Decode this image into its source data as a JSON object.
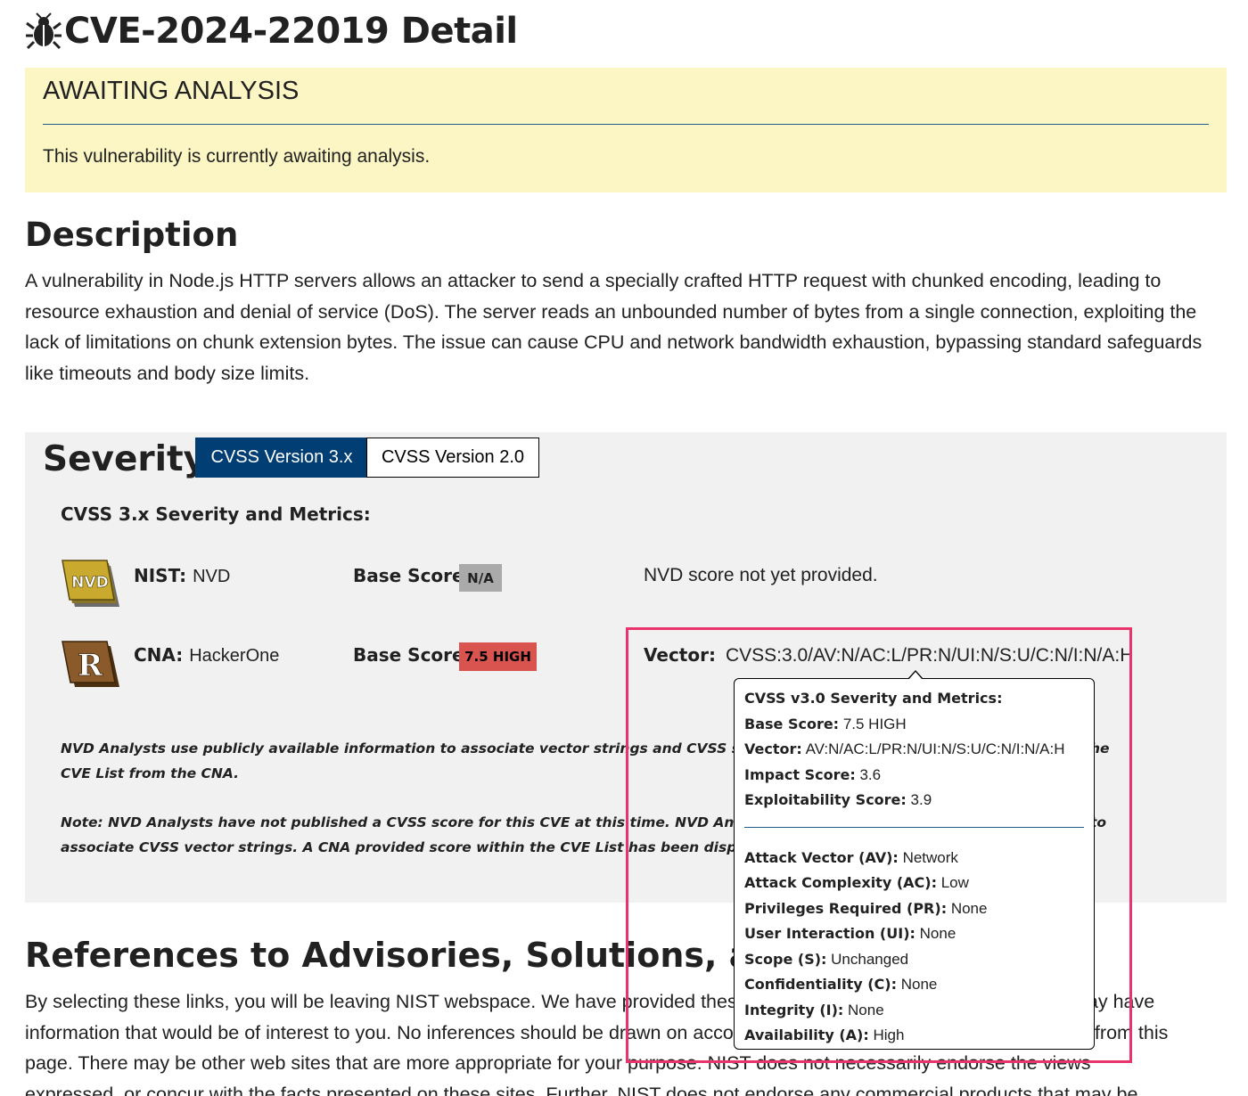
{
  "page": {
    "title": "CVE-2024-22019 Detail",
    "title_icon": "bug-icon"
  },
  "awaiting": {
    "title": "AWAITING ANALYSIS",
    "text": "This vulnerability is currently awaiting analysis."
  },
  "description": {
    "title": "Description",
    "text": "A vulnerability in Node.js HTTP servers allows an attacker to send a specially crafted HTTP request with chunked encoding, leading to resource exhaustion and denial of service (DoS). The server reads an unbounded number of bytes from a single connection, exploiting the lack of limitations on chunk extension bytes. The issue can cause CPU and network bandwidth exhaustion, bypassing standard safeguards like timeouts and body size limits."
  },
  "severity": {
    "title": "Severity",
    "tabs": [
      "CVSS Version 3.x",
      "CVSS Version 2.0"
    ],
    "metrics_title": "CVSS 3.x Severity and Metrics:",
    "nist_label": "NIST:",
    "nist_value": "NVD",
    "nvd_badge": "NVD",
    "base_score_label": "Base Score:",
    "nist_score": "N/A",
    "nist_note": "NVD score not yet provided.",
    "cna_label": "CNA:",
    "cna_value": "HackerOne",
    "cna_badge": "R",
    "cna_score": "7.5 HIGH",
    "vector_label": "Vector:",
    "vector_value": "CVSS:3.0/AV:N/AC:L/PR:N/UI:N/S:U/C:N/I:N/A:H",
    "note1_line1": "NVD Analysts use publicly available information to associate vector strings and CVSS scores. We c",
    "note1_tail": "he",
    "note1_line2": "CVE List from the CNA.",
    "note2_line1": "Note: NVD Analysts have not published a CVSS score for this CVE at this time. NVD Analysts use pu",
    "note2_tail": "to",
    "note2_line2": "associate CVSS vector strings. A CNA provided score within the CVE List has been displayed."
  },
  "tooltip": {
    "title": "CVSS v3.0 Severity and Metrics:",
    "base_score_label": "Base Score:",
    "base_score": "7.5 HIGH",
    "vector_label": "Vector:",
    "vector": "AV:N/AC:L/PR:N/UI:N/S:U/C:N/I:N/A:H",
    "impact_label": "Impact Score:",
    "impact": "3.6",
    "exploit_label": "Exploitability Score:",
    "exploit": "3.9",
    "metrics": [
      {
        "label": "Attack Vector (AV):",
        "value": "Network"
      },
      {
        "label": "Attack Complexity (AC):",
        "value": "Low"
      },
      {
        "label": "Privileges Required (PR):",
        "value": "None"
      },
      {
        "label": "User Interaction (UI):",
        "value": "None"
      },
      {
        "label": "Scope (S):",
        "value": "Unchanged"
      },
      {
        "label": "Confidentiality (C):",
        "value": "None"
      },
      {
        "label": "Integrity (I):",
        "value": "None"
      },
      {
        "label": "Availability (A):",
        "value": "High"
      }
    ]
  },
  "references": {
    "title": "References to Advisories, Solutions, and Tools",
    "text": "By selecting these links, you will be leaving NIST webspace. We have provided these links to other web sites because they may have information that would be of interest to you. No inferences should be drawn on account of other sites being referenced, or not, from this page. There may be other web sites that are more appropriate for your purpose. NIST does not necessarily endorse the views expressed, or concur with the facts presented on these sites. Further, NIST does not endorse any commercial products that may be mentioned on"
  },
  "colors": {
    "accent": "#003e74",
    "awaiting_bg": "#fbf6c3",
    "high": "#d9534f",
    "na": "#aaaaaa",
    "highlight": "#e8336d"
  }
}
